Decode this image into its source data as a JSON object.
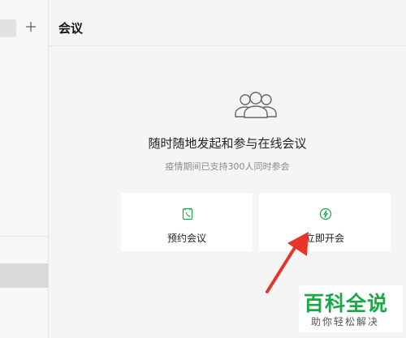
{
  "header": {
    "title": "会议"
  },
  "sidebar": {
    "add_icon": "plus-icon"
  },
  "hero": {
    "icon": "people-group-icon",
    "headline": "随时随地发起和参与在线会议",
    "subline": "疫情期间已支持300人同时参会"
  },
  "actions": {
    "schedule": {
      "label": "预约会议",
      "icon": "phone-calendar-icon"
    },
    "start": {
      "label": "立即开会",
      "icon": "lightning-circle-icon"
    }
  },
  "watermark": {
    "title": "百科全说",
    "subtitle": "助你轻松解决"
  },
  "colors": {
    "accent_green": "#1aa846",
    "arrow_red": "#e8332a"
  }
}
